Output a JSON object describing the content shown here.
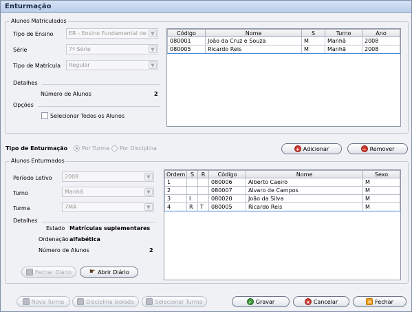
{
  "window": {
    "title": "Enturmação"
  },
  "enrolled": {
    "group_label": "Alunos Matriculados",
    "tipo_ensino_label": "Tipo de Ensino",
    "tipo_ensino_value": "ER - Ensino Fundamental de ...",
    "serie_label": "Série",
    "serie_value": "7ª Série",
    "tipo_matricula_label": "Tipo de Matrícula",
    "tipo_matricula_value": "Regular",
    "detalhes_label": "Detalhes",
    "num_alunos_label": "Número de Alunos",
    "num_alunos_value": "2",
    "opcoes_label": "Opções",
    "select_all_label": "Selecionar Todos os Alunos",
    "columns": [
      "Código",
      "Nome",
      "S",
      "Turno",
      "Ano"
    ],
    "rows": [
      [
        "080001",
        "João da Cruz e Souza",
        "M",
        "Manhã",
        "2008"
      ],
      [
        "080005",
        "Ricardo Reis",
        "M",
        "Manhã",
        "2008"
      ]
    ]
  },
  "type": {
    "label": "Tipo de Enturmação",
    "option_turma": "Por Turma",
    "option_disciplina": "Por Disciplina",
    "selected": "Por Turma"
  },
  "actions": {
    "adicionar": "Adicionar",
    "remover": "Remover"
  },
  "assigned": {
    "group_label": "Alunos Enturmados",
    "periodo_label": "Período Letivo",
    "periodo_value": "2008",
    "turno_label": "Turno",
    "turno_value": "Manhã",
    "turma_label": "Turma",
    "turma_value": "7MA",
    "detalhes_label": "Detalhes",
    "estado_label": "Estado",
    "estado_value": "Matrículas suplementares",
    "ordenacao_label": "Ordenação",
    "ordenacao_value": "alfabética",
    "num_alunos_label": "Número de Alunos",
    "num_alunos_value": "2",
    "fechar_diario": "Fechar Diário",
    "abrir_diario": "Abrir Diário",
    "columns": [
      "Ordem",
      "S",
      "R",
      "Código",
      "Nome",
      "Sexo"
    ],
    "rows": [
      [
        "1",
        "",
        "",
        "080006",
        "Alberto Caeiro",
        "M"
      ],
      [
        "2",
        "",
        "",
        "080007",
        "Alvaro de Campos",
        "M"
      ],
      [
        "3",
        "I",
        "",
        "080020",
        "João da Silva",
        "M"
      ],
      [
        "4",
        "R",
        "T",
        "080005",
        "Ricardo Reis",
        "M"
      ]
    ]
  },
  "footer": {
    "nova_turma": "Nova Turma",
    "disciplina_isolada": "Disciplina Isolada",
    "selecionar_turma": "Selecionar Turma",
    "gravar": "Gravar",
    "cancelar": "Cancelar",
    "fechar": "Fechar"
  },
  "icons": {
    "adicionar": "add-circle-icon",
    "remover": "remove-circle-icon",
    "fechar_diario": "book-icon",
    "abrir_diario": "hand-icon",
    "gravar": "check-icon",
    "cancelar": "cancel-icon",
    "fechar": "close-icon"
  }
}
